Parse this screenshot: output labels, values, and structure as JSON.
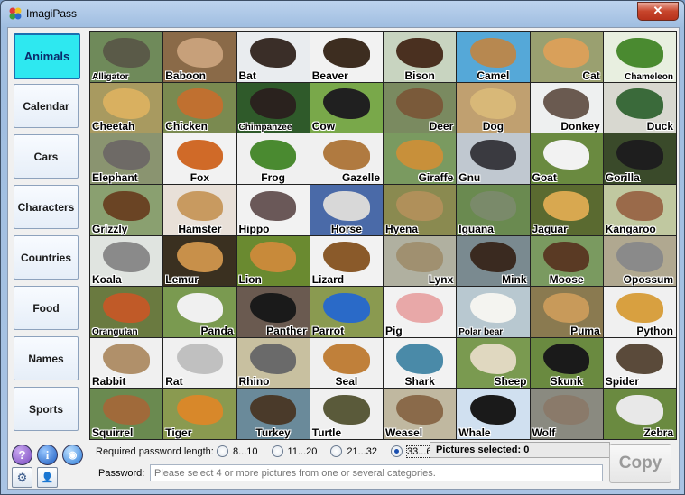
{
  "window": {
    "title": "ImagiPass",
    "close_glyph": "✕"
  },
  "categories": [
    {
      "label": "Animals",
      "active": true
    },
    {
      "label": "Calendar"
    },
    {
      "label": "Cars"
    },
    {
      "label": "Characters"
    },
    {
      "label": "Countries"
    },
    {
      "label": "Food"
    },
    {
      "label": "Names"
    },
    {
      "label": "Sports"
    }
  ],
  "tiles": [
    {
      "label": "Alligator",
      "bg": "#6f8a5a",
      "fg": "#5a5a48",
      "pos": "l"
    },
    {
      "label": "Baboon",
      "bg": "#8a6a48",
      "fg": "#c7a07a",
      "pos": "l"
    },
    {
      "label": "Bat",
      "bg": "#e9ecef",
      "fg": "#3a2e28",
      "pos": "l"
    },
    {
      "label": "Beaver",
      "bg": "#f2f2f2",
      "fg": "#3d2d20",
      "pos": "l"
    },
    {
      "label": "Bison",
      "bg": "#c8d4c0",
      "fg": "#4a3020",
      "pos": "c"
    },
    {
      "label": "Camel",
      "bg": "#55a8d8",
      "fg": "#b78850",
      "pos": "c"
    },
    {
      "label": "Cat",
      "bg": "#9aa070",
      "fg": "#d9a05a",
      "pos": "r"
    },
    {
      "label": "Chameleon",
      "bg": "#e8efe0",
      "fg": "#4a8a30",
      "pos": "r"
    },
    {
      "label": "Cheetah",
      "bg": "#a89a60",
      "fg": "#d9b060",
      "pos": "l"
    },
    {
      "label": "Chicken",
      "bg": "#7a8a50",
      "fg": "#c07030",
      "pos": "l"
    },
    {
      "label": "Chimpanzee",
      "bg": "#2f5a2a",
      "fg": "#2a221e",
      "pos": "l"
    },
    {
      "label": "Cow",
      "bg": "#79a84a",
      "fg": "#202020",
      "pos": "l"
    },
    {
      "label": "Deer",
      "bg": "#7a8a60",
      "fg": "#7a5a3a",
      "pos": "r"
    },
    {
      "label": "Dog",
      "bg": "#c0a070",
      "fg": "#d8b878",
      "pos": "c"
    },
    {
      "label": "Donkey",
      "bg": "#eef0f0",
      "fg": "#6a5a50",
      "pos": "r"
    },
    {
      "label": "Duck",
      "bg": "#d8d8d0",
      "fg": "#3a6a3a",
      "pos": "r"
    },
    {
      "label": "Elephant",
      "bg": "#8a9470",
      "fg": "#6e6a66",
      "pos": "l"
    },
    {
      "label": "Fox",
      "bg": "#f2f2f2",
      "fg": "#d06a28",
      "pos": "c"
    },
    {
      "label": "Frog",
      "bg": "#f0f0f0",
      "fg": "#4a8a30",
      "pos": "c"
    },
    {
      "label": "Gazelle",
      "bg": "#f0f0f0",
      "fg": "#b07a40",
      "pos": "r"
    },
    {
      "label": "Giraffe",
      "bg": "#7a9a60",
      "fg": "#c8903a",
      "pos": "r"
    },
    {
      "label": "Gnu",
      "bg": "#c0c8d0",
      "fg": "#3a3a40",
      "pos": "l"
    },
    {
      "label": "Goat",
      "bg": "#6a8a40",
      "fg": "#f2f2f2",
      "pos": "l"
    },
    {
      "label": "Gorilla",
      "bg": "#3a4a2a",
      "fg": "#1e1e1e",
      "pos": "l"
    },
    {
      "label": "Grizzly",
      "bg": "#8aa070",
      "fg": "#6a4424",
      "pos": "l"
    },
    {
      "label": "Hamster",
      "bg": "#e8e0d8",
      "fg": "#c89a60",
      "pos": "c"
    },
    {
      "label": "Hippo",
      "bg": "#f2f2f2",
      "fg": "#6a5858",
      "pos": "l"
    },
    {
      "label": "Horse",
      "bg": "#4a6aa8",
      "fg": "#d8d8d8",
      "pos": "c"
    },
    {
      "label": "Hyena",
      "bg": "#8a8a50",
      "fg": "#b0905a",
      "pos": "l"
    },
    {
      "label": "Iguana",
      "bg": "#6a8a50",
      "fg": "#7a8a6a",
      "pos": "l"
    },
    {
      "label": "Jaguar",
      "bg": "#5a6a30",
      "fg": "#d8a850",
      "pos": "l"
    },
    {
      "label": "Kangaroo",
      "bg": "#c0c8a0",
      "fg": "#9a6a4a",
      "pos": "l"
    },
    {
      "label": "Koala",
      "bg": "#e0e4e0",
      "fg": "#8a8a8a",
      "pos": "l"
    },
    {
      "label": "Lemur",
      "bg": "#3a3020",
      "fg": "#c8904a",
      "pos": "l"
    },
    {
      "label": "Lion",
      "bg": "#6a8a30",
      "fg": "#c88a3a",
      "pos": "l"
    },
    {
      "label": "Lizard",
      "bg": "#f2f2f2",
      "fg": "#8a5a2a",
      "pos": "l"
    },
    {
      "label": "Lynx",
      "bg": "#b0b0a0",
      "fg": "#a09070",
      "pos": "r"
    },
    {
      "label": "Mink",
      "bg": "#7a8a90",
      "fg": "#3a2a20",
      "pos": "r"
    },
    {
      "label": "Moose",
      "bg": "#7a9a60",
      "fg": "#5a3a24",
      "pos": "c"
    },
    {
      "label": "Opossum",
      "bg": "#b0a890",
      "fg": "#8a8a8a",
      "pos": "r"
    },
    {
      "label": "Orangutan",
      "bg": "#6a7a40",
      "fg": "#c05a28",
      "pos": "l"
    },
    {
      "label": "Panda",
      "bg": "#7a9a50",
      "fg": "#f0f0f0",
      "pos": "r"
    },
    {
      "label": "Panther",
      "bg": "#6a5a50",
      "fg": "#1a1a1a",
      "pos": "r"
    },
    {
      "label": "Parrot",
      "bg": "#8a9a50",
      "fg": "#2a6ac8",
      "pos": "l"
    },
    {
      "label": "Pig",
      "bg": "#f2f2f2",
      "fg": "#e8a8a8",
      "pos": "l"
    },
    {
      "label": "Polar bear",
      "bg": "#b8c8d0",
      "fg": "#f4f4f0",
      "pos": "l"
    },
    {
      "label": "Puma",
      "bg": "#8a7a50",
      "fg": "#c89a5a",
      "pos": "r"
    },
    {
      "label": "Python",
      "bg": "#f0f0f0",
      "fg": "#d8a040",
      "pos": "r"
    },
    {
      "label": "Rabbit",
      "bg": "#f0f0f0",
      "fg": "#b0906a",
      "pos": "l"
    },
    {
      "label": "Rat",
      "bg": "#f0f0f0",
      "fg": "#c0c0c0",
      "pos": "l"
    },
    {
      "label": "Rhino",
      "bg": "#c8c0a0",
      "fg": "#6a6a6a",
      "pos": "l"
    },
    {
      "label": "Seal",
      "bg": "#f0f0f0",
      "fg": "#c0803a",
      "pos": "c"
    },
    {
      "label": "Shark",
      "bg": "#f2f2f2",
      "fg": "#4a8aa8",
      "pos": "c"
    },
    {
      "label": "Sheep",
      "bg": "#7a9a50",
      "fg": "#e0d8c0",
      "pos": "r"
    },
    {
      "label": "Skunk",
      "bg": "#6a8a40",
      "fg": "#1a1a1a",
      "pos": "c"
    },
    {
      "label": "Spider",
      "bg": "#f0f0f0",
      "fg": "#5a4a3a",
      "pos": "l"
    },
    {
      "label": "Squirrel",
      "bg": "#6a8a50",
      "fg": "#a06a3a",
      "pos": "l"
    },
    {
      "label": "Tiger",
      "bg": "#8a9a50",
      "fg": "#d8882a",
      "pos": "l"
    },
    {
      "label": "Turkey",
      "bg": "#6a8a9a",
      "fg": "#4a3a2a",
      "pos": "c"
    },
    {
      "label": "Turtle",
      "bg": "#f0f0f0",
      "fg": "#5a5a3a",
      "pos": "l"
    },
    {
      "label": "Weasel",
      "bg": "#c0b8a0",
      "fg": "#8a6a4a",
      "pos": "l"
    },
    {
      "label": "Whale",
      "bg": "#d0e0f0",
      "fg": "#1a1a1a",
      "pos": "l"
    },
    {
      "label": "Wolf",
      "bg": "#8a8a80",
      "fg": "#8a7a6a",
      "pos": "l"
    },
    {
      "label": "Zebra",
      "bg": "#6a8a40",
      "fg": "#e8e8e8",
      "pos": "r"
    }
  ],
  "toolbar": {
    "help_glyph": "?",
    "info_glyph": "i",
    "web_glyph": "◉",
    "settings_glyph": "⚙",
    "user_glyph": "👤"
  },
  "password": {
    "length_label": "Required password length:",
    "options": [
      {
        "label": "8...10"
      },
      {
        "label": "11...20"
      },
      {
        "label": "21...32"
      },
      {
        "label": "33...64",
        "selected": true
      }
    ],
    "pictures_selected": "Pictures selected: 0",
    "field_label": "Password:",
    "placeholder": "Please select 4 or more pictures from one or several categories.",
    "copy_label": "Copy"
  },
  "colors": {
    "active_category": "#2ee8f0",
    "help_button": "#8a5ac8",
    "info_button": "#2a6ad0",
    "web_button": "#3a8ae0"
  }
}
